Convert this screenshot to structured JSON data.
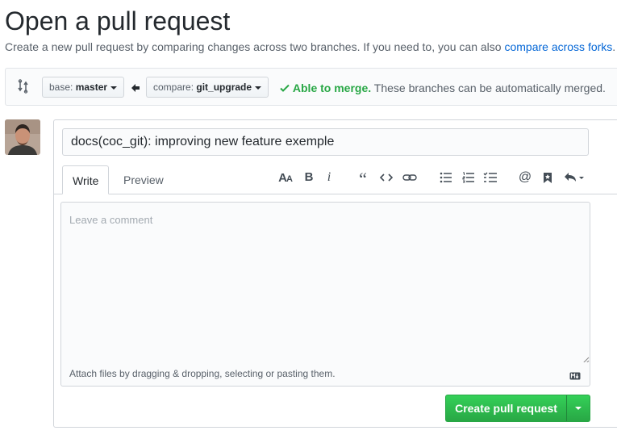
{
  "page": {
    "title": "Open a pull request",
    "subtitle_text": "Create a new pull request by comparing changes across two branches. If you need to, you can also ",
    "subtitle_link": "compare across forks",
    "subtitle_end": "."
  },
  "range": {
    "base_label": "base:",
    "base_value": "master",
    "compare_label": "compare:",
    "compare_value": "git_upgrade",
    "merge_status": "Able to merge.",
    "merge_detail": " These branches can be automatically merged."
  },
  "form": {
    "title_value": "docs(coc_git): improving new feature exemple",
    "tabs": [
      {
        "label": "Write"
      },
      {
        "label": "Preview"
      }
    ],
    "comment_placeholder": "Leave a comment",
    "attach_text": "Attach files by dragging & dropping, selecting or pasting them.",
    "submit_label": "Create pull request"
  },
  "toolbar": {
    "icons": [
      "text-size-icon",
      "bold-icon",
      "italic-icon",
      "quote-icon",
      "code-icon",
      "link-icon",
      "unordered-list-icon",
      "ordered-list-icon",
      "task-list-icon",
      "mention-icon",
      "bookmark-icon",
      "reply-icon"
    ]
  },
  "colors": {
    "link": "#0366d6",
    "success": "#28a745",
    "button_green": "#2ea44f"
  }
}
